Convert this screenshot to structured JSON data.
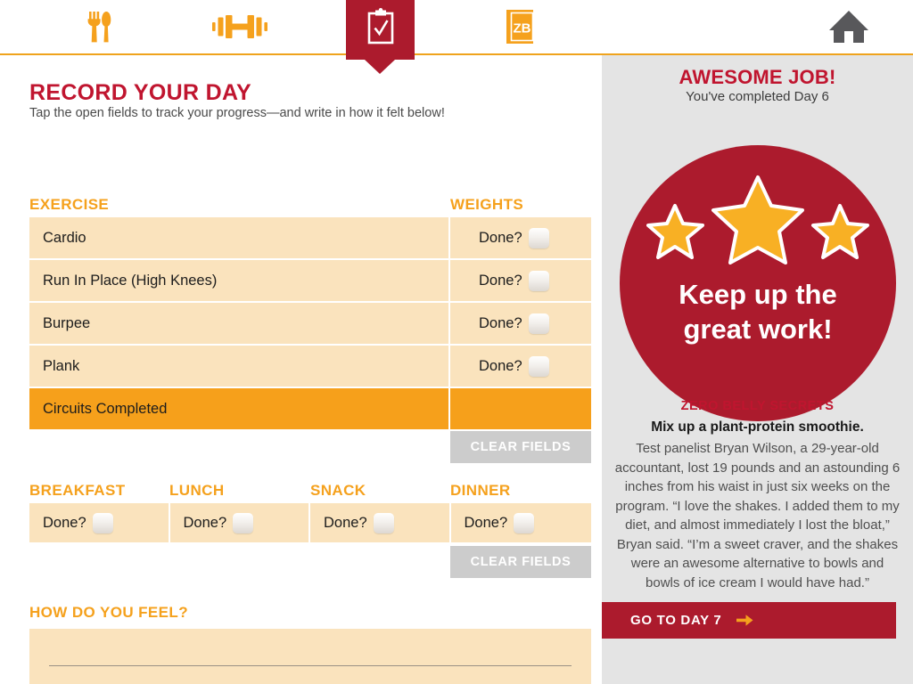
{
  "colors": {
    "brand_red": "#ac1b2d",
    "title_red": "#c0152f",
    "orange": "#f5a11d",
    "highlight_orange": "#f6a01b",
    "field_tan": "#fae3bd",
    "sidebar_gray": "#e4e4e4",
    "clear_button_gray": "#cccccc",
    "home_icon_gray": "#58585b"
  },
  "nav": {
    "items": [
      {
        "icon": "fork-and-knife-icon",
        "label": "Eat",
        "active": false
      },
      {
        "icon": "dumbbell-icon",
        "label": "Move",
        "active": false
      },
      {
        "icon": "clipboard-check-icon",
        "label": "Record",
        "active": true
      },
      {
        "icon": "zb-book-icon",
        "label": "ZB",
        "active": false
      },
      {
        "icon": "home-icon",
        "label": "Home",
        "active": false
      }
    ]
  },
  "main": {
    "title": "RECORD YOUR DAY",
    "subtitle": "Tap the open fields to track your progress—and write in how it felt below!",
    "exercise": {
      "col_exercise": "EXERCISE",
      "col_weights": "WEIGHTS",
      "rows": [
        {
          "name": "Cardio",
          "value": "Done?",
          "has_checkbox": true,
          "highlight": false
        },
        {
          "name": "Run In Place (High Knees)",
          "value": "Done?",
          "has_checkbox": true,
          "highlight": false
        },
        {
          "name": "Burpee",
          "value": "Done?",
          "has_checkbox": true,
          "highlight": false
        },
        {
          "name": "Plank",
          "value": "Done?",
          "has_checkbox": true,
          "highlight": false
        },
        {
          "name": "Circuits Completed",
          "value": "",
          "has_checkbox": false,
          "highlight": true
        }
      ],
      "clear_label": "CLEAR FIELDS"
    },
    "meals": {
      "headers": [
        "BREAKFAST",
        "LUNCH",
        "SNACK",
        "DINNER"
      ],
      "cells": [
        {
          "header": "BREAKFAST",
          "value": "Done?"
        },
        {
          "header": "LUNCH",
          "value": "Done?"
        },
        {
          "header": "SNACK",
          "value": "Done?"
        },
        {
          "header": "DINNER",
          "value": "Done?"
        }
      ],
      "clear_label": "CLEAR FIELDS"
    },
    "feel": {
      "heading": "HOW DO YOU FEEL?",
      "value": "",
      "placeholder": ""
    }
  },
  "sidebar": {
    "title": "AWESOME JOB!",
    "subtitle": "You've completed Day 6",
    "badge": {
      "line1": "Keep up the",
      "line2": "great work!",
      "stars": 3
    },
    "secrets": {
      "kicker": "ZERO BELLY SECRETS",
      "lead": "Mix up a plant-protein smoothie.",
      "body": "Test panelist Bryan Wilson, a 29-year-old accountant, lost 19 pounds and an astounding 6 inches from his waist in just six weeks on the program. “I love the shakes. I added them to my diet, and almost immediately I lost the bloat,” Bryan said. “I’m a sweet craver, and the shakes were an awesome alternative to bowls and bowls of ice cream I would have had.”"
    },
    "cta": {
      "label": "GO TO DAY 7",
      "icon": "arrow-right-icon"
    }
  }
}
